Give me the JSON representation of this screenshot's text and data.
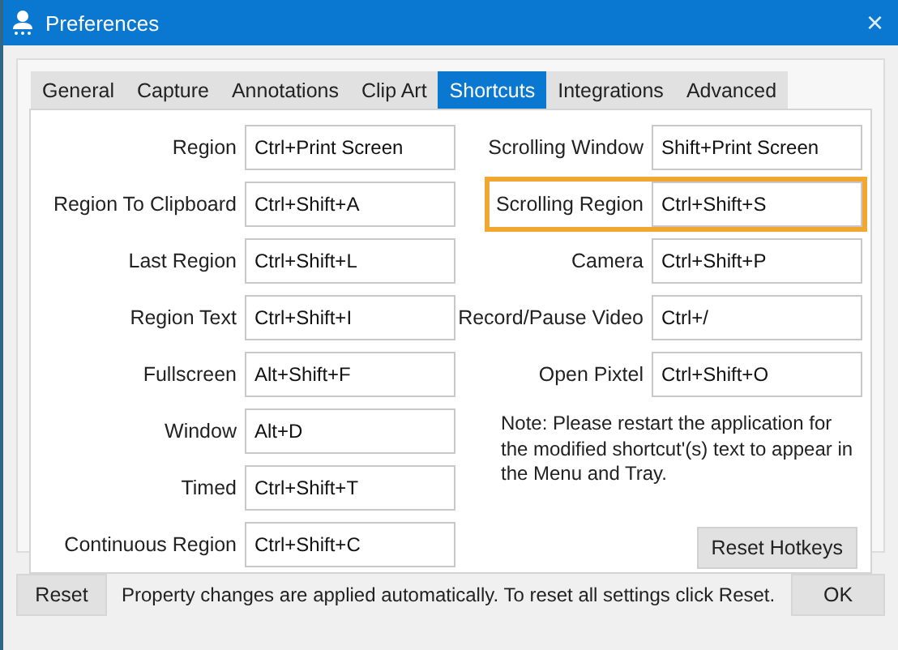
{
  "window": {
    "title": "Preferences",
    "close": "×"
  },
  "tabs": [
    {
      "label": "General",
      "selected": false
    },
    {
      "label": "Capture",
      "selected": false
    },
    {
      "label": "Annotations",
      "selected": false
    },
    {
      "label": "Clip Art",
      "selected": false
    },
    {
      "label": "Shortcuts",
      "selected": true
    },
    {
      "label": "Integrations",
      "selected": false
    },
    {
      "label": "Advanced",
      "selected": false
    }
  ],
  "shortcuts_left": [
    {
      "label": "Region",
      "value": "Ctrl+Print Screen",
      "highlighted": false
    },
    {
      "label": "Region To Clipboard",
      "value": "Ctrl+Shift+A",
      "highlighted": false
    },
    {
      "label": "Last Region",
      "value": "Ctrl+Shift+L",
      "highlighted": false
    },
    {
      "label": "Region Text",
      "value": "Ctrl+Shift+I",
      "highlighted": false
    },
    {
      "label": "Fullscreen",
      "value": "Alt+Shift+F",
      "highlighted": false
    },
    {
      "label": "Window",
      "value": "Alt+D",
      "highlighted": false
    },
    {
      "label": "Timed",
      "value": "Ctrl+Shift+T",
      "highlighted": false
    },
    {
      "label": "Continuous Region",
      "value": "Ctrl+Shift+C",
      "highlighted": false
    }
  ],
  "shortcuts_right": [
    {
      "label": "Scrolling Window",
      "value": "Shift+Print Screen",
      "highlighted": false
    },
    {
      "label": "Scrolling Region",
      "value": "Ctrl+Shift+S",
      "highlighted": true
    },
    {
      "label": "Camera",
      "value": "Ctrl+Shift+P",
      "highlighted": false
    },
    {
      "label": "Record/Pause Video",
      "value": "Ctrl+/",
      "highlighted": false
    },
    {
      "label": "Open Pixtel",
      "value": "Ctrl+Shift+O",
      "highlighted": false
    }
  ],
  "note": "Note: Please restart the application for the modified shortcut'(s) text to appear in the Menu and Tray.",
  "reset_hotkeys_button": "Reset Hotkeys",
  "footer": {
    "reset_button": "Reset",
    "message": "Property changes are applied automatically. To reset all settings click Reset.",
    "ok_button": "OK"
  }
}
